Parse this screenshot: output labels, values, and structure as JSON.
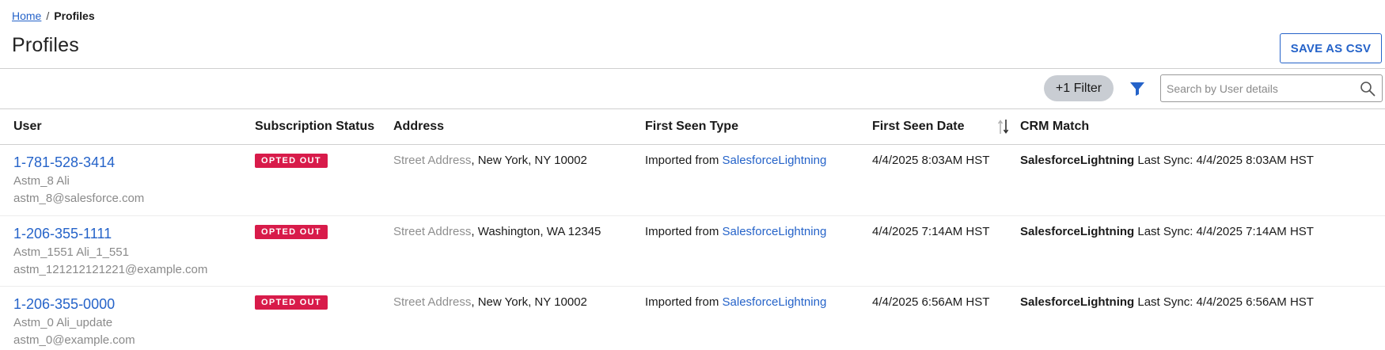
{
  "breadcrumb": {
    "home": "Home",
    "separator": "/",
    "current": "Profiles"
  },
  "page_title": "Profiles",
  "toolbar": {
    "save_csv_label": "SAVE AS CSV",
    "filter_count_label": "+1 Filter",
    "search_placeholder": "Search by User details"
  },
  "table": {
    "headers": {
      "user": "User",
      "subscription_status": "Subscription Status",
      "address": "Address",
      "first_seen_type": "First Seen Type",
      "first_seen_date": "First Seen Date",
      "crm_match": "CRM Match"
    },
    "rows": [
      {
        "phone": "1-781-528-3414",
        "name": "Astm_8 Ali",
        "email": "astm_8@salesforce.com",
        "status": "OPTED OUT",
        "address_label": "Street Address",
        "address_rest": ", New York, NY 10002",
        "first_seen_prefix": "Imported from ",
        "first_seen_source": "SalesforceLightning",
        "first_seen_date": "4/4/2025 8:03AM HST",
        "crm_name": "SalesforceLightning",
        "crm_sync": " Last Sync: 4/4/2025 8:03AM HST"
      },
      {
        "phone": "1-206-355-1111",
        "name": "Astm_1551 Ali_1_551",
        "email": "astm_121212121221@example.com",
        "status": "OPTED OUT",
        "address_label": "Street Address",
        "address_rest": ", Washington, WA 12345",
        "first_seen_prefix": "Imported from ",
        "first_seen_source": "SalesforceLightning",
        "first_seen_date": "4/4/2025 7:14AM HST",
        "crm_name": "SalesforceLightning",
        "crm_sync": " Last Sync: 4/4/2025 7:14AM HST"
      },
      {
        "phone": "1-206-355-0000",
        "name": "Astm_0 Ali_update",
        "email": "astm_0@example.com",
        "status": "OPTED OUT",
        "address_label": "Street Address",
        "address_rest": ", New York, NY 10002",
        "first_seen_prefix": "Imported from ",
        "first_seen_source": "SalesforceLightning",
        "first_seen_date": "4/4/2025 6:56AM HST",
        "crm_name": "SalesforceLightning",
        "crm_sync": " Last Sync: 4/4/2025 6:56AM HST"
      }
    ]
  },
  "colors": {
    "accent": "#2563c9",
    "badge": "#d81b4a",
    "filter_pill": "#c9cdd3",
    "muted_text": "#8a8a8a"
  },
  "icons": {
    "filter": "funnel-icon",
    "search": "magnifier-icon",
    "sort": "sort-arrows-icon"
  }
}
